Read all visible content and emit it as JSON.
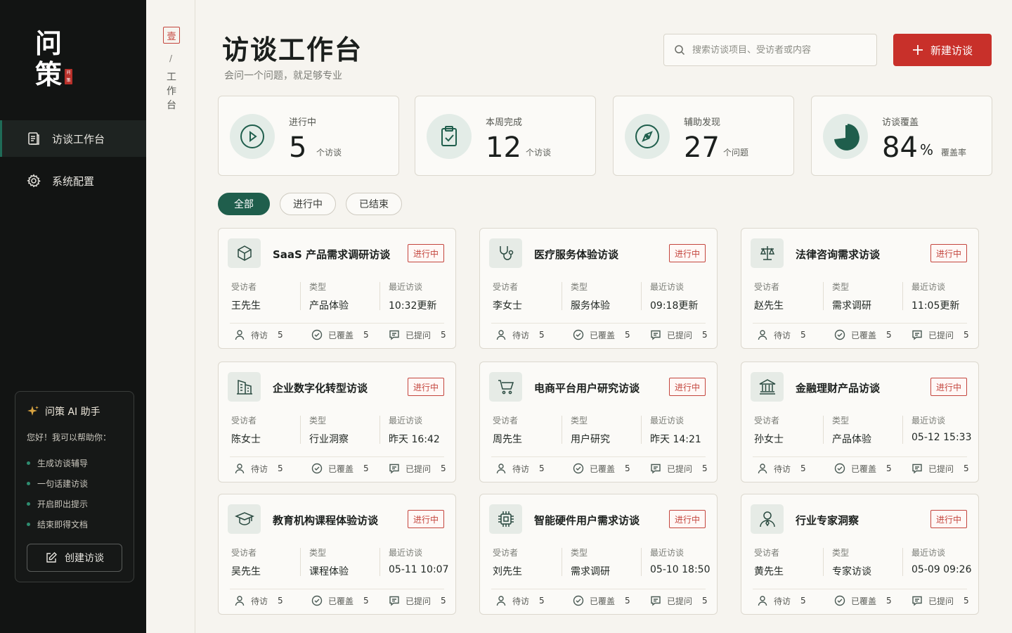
{
  "brand": {
    "line1": "问",
    "line2": "策",
    "seal": "问策"
  },
  "sidebar": {
    "items": [
      {
        "label": "访谈工作台",
        "icon": "workbench-icon",
        "active": true
      },
      {
        "label": "系统配置",
        "icon": "gear-icon",
        "active": false
      }
    ]
  },
  "assistant": {
    "title": "问策 AI 助手",
    "greeting": "您好！我可以帮助你：",
    "features": [
      "生成访谈辅导",
      "一句话建访谈",
      "开启即出提示",
      "结束即得文档"
    ],
    "create_label": "创建访谈"
  },
  "rail": {
    "seal": "壹",
    "slash": "/",
    "text": "工作台"
  },
  "header": {
    "title": "访谈工作台",
    "subtitle": "会问一个问题，就足够专业",
    "search_placeholder": "搜索访谈项目、受访者或内容",
    "new_label": "新建访谈"
  },
  "stats": [
    {
      "label": "进行中",
      "value": "5",
      "unit": "个访谈",
      "icon": "play-icon"
    },
    {
      "label": "本周完成",
      "value": "12",
      "unit": "个访谈",
      "icon": "clipboard-check-icon"
    },
    {
      "label": "辅助发现",
      "value": "27",
      "unit": "个问题",
      "icon": "compass-icon"
    },
    {
      "label": "访谈覆盖",
      "value": "84",
      "pct": "%",
      "unit": "覆盖率",
      "icon": "pie-chart-icon"
    }
  ],
  "filters": [
    "全部",
    "进行中",
    "已结束"
  ],
  "card_labels": {
    "interviewee": "受访者",
    "type": "类型",
    "recent": "最近访谈",
    "pending": "待访",
    "covered": "已覆盖",
    "asked": "已提问"
  },
  "cards": [
    {
      "title": "SaaS 产品需求调研访谈",
      "status": "进行中",
      "interviewee": "王先生",
      "type": "产品体验",
      "recent": "10:32更新",
      "pending": "5",
      "covered": "5",
      "asked": "5",
      "icon": "cube-icon"
    },
    {
      "title": "医疗服务体验访谈",
      "status": "进行中",
      "interviewee": "李女士",
      "type": "服务体验",
      "recent": "09:18更新",
      "pending": "5",
      "covered": "5",
      "asked": "5",
      "icon": "stethoscope-icon"
    },
    {
      "title": "法律咨询需求访谈",
      "status": "进行中",
      "interviewee": "赵先生",
      "type": "需求调研",
      "recent": "11:05更新",
      "pending": "5",
      "covered": "5",
      "asked": "5",
      "icon": "scale-icon"
    },
    {
      "title": "企业数字化转型访谈",
      "status": "进行中",
      "interviewee": "陈女士",
      "type": "行业洞察",
      "recent": "昨天 16:42",
      "pending": "5",
      "covered": "5",
      "asked": "5",
      "icon": "building-icon"
    },
    {
      "title": "电商平台用户研究访谈",
      "status": "进行中",
      "interviewee": "周先生",
      "type": "用户研究",
      "recent": "昨天 14:21",
      "pending": "5",
      "covered": "5",
      "asked": "5",
      "icon": "cart-icon"
    },
    {
      "title": "金融理财产品访谈",
      "status": "进行中",
      "interviewee": "孙女士",
      "type": "产品体验",
      "recent": "05-12 15:33",
      "pending": "5",
      "covered": "5",
      "asked": "5",
      "icon": "bank-icon"
    },
    {
      "title": "教育机构课程体验访谈",
      "status": "进行中",
      "interviewee": "吴先生",
      "type": "课程体验",
      "recent": "05-11 10:07",
      "pending": "5",
      "covered": "5",
      "asked": "5",
      "icon": "graduation-cap-icon"
    },
    {
      "title": "智能硬件用户需求访谈",
      "status": "进行中",
      "interviewee": "刘先生",
      "type": "需求调研",
      "recent": "05-10 18:50",
      "pending": "5",
      "covered": "5",
      "asked": "5",
      "icon": "chip-icon"
    },
    {
      "title": "行业专家洞察",
      "status": "进行中",
      "interviewee": "黄先生",
      "type": "专家访谈",
      "recent": "05-09 09:26",
      "pending": "5",
      "covered": "5",
      "asked": "5",
      "icon": "expert-icon"
    }
  ],
  "colors": {
    "accent": "#1f5e4c",
    "danger": "#c8302a",
    "sidebar": "#121413"
  }
}
